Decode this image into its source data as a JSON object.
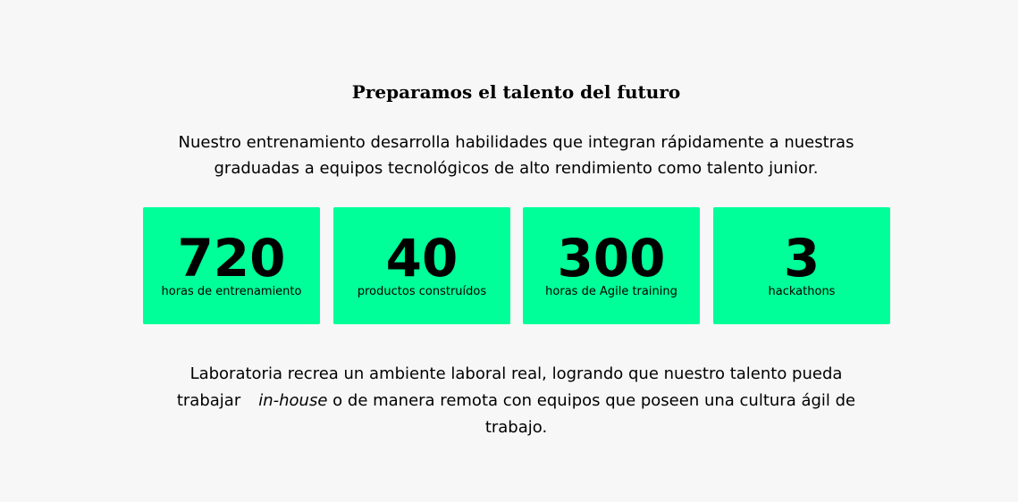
{
  "section": {
    "title": "Preparamos el talento del futuro",
    "intro": "Nuestro entrenamiento desarrolla habilidades que integran rápidamente a nuestras graduadas a equipos tecnológicos de alto rendimiento como talento junior.",
    "stats": [
      {
        "value": "720",
        "label": "horas de entrenamiento"
      },
      {
        "value": "40",
        "label": "productos construídos"
      },
      {
        "value": "300",
        "label": "horas de Agile training"
      },
      {
        "value": "3",
        "label": "hackathons"
      }
    ],
    "outro": {
      "before": "Laboratoria recrea un ambiente laboral real, logrando que nuestro talento pueda trabajar",
      "emphasis": "in-house",
      "after": "o de manera remota con equipos que poseen una cultura ágil de trabajo."
    }
  },
  "colors": {
    "background": "#f7f7f7",
    "accent": "#00ff98",
    "text": "#000000"
  }
}
